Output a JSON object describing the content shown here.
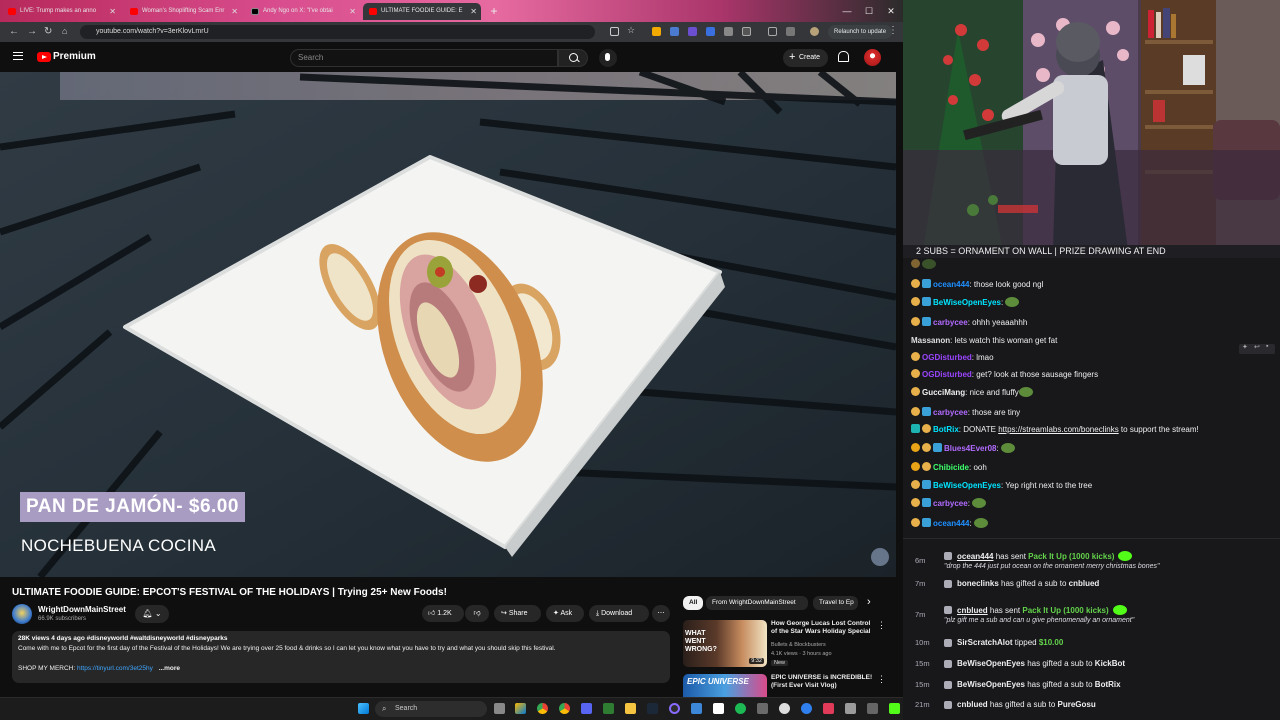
{
  "browser": {
    "tabs": [
      {
        "label": "LIVE: Trump makes an anno"
      },
      {
        "label": "Woman's Shoplifting Scam Enr"
      },
      {
        "label": "Andy Ngo on X: \"I've obtai"
      },
      {
        "label": "ULTIMATE FOODIE GUIDE: E"
      }
    ],
    "url": "youtube.com/watch?v=3erKlovLmrU",
    "relaunch_label": "Relaunch to update"
  },
  "youtube": {
    "brand": "Premium",
    "search_placeholder": "Search",
    "create_label": "Create",
    "caption_title": "PAN DE JAMÓN- $6.00",
    "caption_subtitle": "NOCHEBUENA COCINA",
    "video_title": "ULTIMATE FOODIE GUIDE: EPCOT'S FESTIVAL OF THE HOLIDAYS | Trying 25+ New Foods!",
    "channel_name": "WrightDownMainStreet",
    "channel_subs": "66.9K subscribers",
    "likes": "1.2K",
    "share_label": "Share",
    "ask_label": "Ask",
    "download_label": "Download",
    "description": {
      "meta": "28K views  4 days ago  #disneyworld #waltdisneyworld #disneyparks",
      "text": "Come with me to Epcot for the first day of the Festival of the Holidays! We are trying over 25 food & drinks so I can let you know what you have to try and what you should skip this festival.",
      "merch_label": "SHOP MY MERCH: ",
      "merch_link": "https://tinyurl.com/3et25hy",
      "more": "...more"
    },
    "chips": [
      "All",
      "From WrightDownMainStreet",
      "Travel to Ep"
    ],
    "related": [
      {
        "title": "How George Lucas Lost Control of the Star Wars Holiday Special",
        "channel": "Bullets & Blockbusters",
        "stats": "4.1K views · 3 hours ago",
        "badge": "New",
        "duration": "9:32",
        "thumb_text": "WHAT WENT WRONG?"
      },
      {
        "title": "EPIC UNIVERSE is INCREDIBLE! (First Ever Visit Vlog)",
        "thumb_text": "EPIC UNIVERSE"
      }
    ]
  },
  "chat": {
    "banner": "2 SUBS = ORNAMENT ON WALL | PRIZE DRAWING AT END",
    "messages": [
      {
        "user": "ocean444",
        "text": "those look good ngl",
        "color": "#1e90ff"
      },
      {
        "user": "BeWiseOpenEyes",
        "text": "",
        "color": "#00e5ff"
      },
      {
        "user": "carbycee",
        "text": "ohhh yeaaahhh",
        "color": "#b26bff"
      },
      {
        "user": "Massanon",
        "text": "lets watch this woman get fat",
        "color": "#e0e0e0"
      },
      {
        "user": "OGDisturbed",
        "text": "lmao",
        "color": "#9b45ff"
      },
      {
        "user": "OGDisturbed",
        "text": "get? look at those sausage fingers",
        "color": "#9b45ff"
      },
      {
        "user": "GucciMang",
        "text": "nice and fluffy",
        "color": "#f0f0f0"
      },
      {
        "user": "carbycee",
        "text": "those are tiny",
        "color": "#b26bff"
      },
      {
        "user": "BotRix",
        "text": "DONATE ",
        "link": "https://streamlabs.com/boneclinks",
        "suffix": " to support the stream!",
        "color": "#00e5ff"
      },
      {
        "user": "Blues4Ever08",
        "text": "",
        "color": "#b26bff"
      },
      {
        "user": "Chibicide",
        "text": "ooh",
        "color": "#3cff6a"
      },
      {
        "user": "BeWiseOpenEyes",
        "text": "Yep right next to the tree",
        "color": "#00e5ff"
      },
      {
        "user": "carbycee",
        "text": "",
        "color": "#b26bff"
      },
      {
        "user": "ocean444",
        "text": "",
        "color": "#1e90ff"
      }
    ]
  },
  "events": [
    {
      "time": "6m",
      "user": "ocean444",
      "action": " has sent ",
      "item": "Pack It Up (1000 kicks)",
      "note": "\"drop the 444 just put ocean on the ornament merry christmas bones\""
    },
    {
      "time": "7m",
      "user": "boneclinks",
      "action": " has gifted a sub to ",
      "target": "cnblued"
    },
    {
      "time": "7m",
      "user": "cnblued",
      "action": " has sent ",
      "item": "Pack It Up (1000 kicks)",
      "note": "\"plz gift me a sub and can u give phenomenally an ornament\""
    },
    {
      "time": "10m",
      "user": "SirScratchAlot",
      "action": " tipped ",
      "item": "$10.00"
    },
    {
      "time": "15m",
      "user": "BeWiseOpenEyes",
      "action": " has gifted a sub to ",
      "target": "KickBot"
    },
    {
      "time": "15m",
      "user": "BeWiseOpenEyes",
      "action": " has gifted a sub to ",
      "target": "BotRix"
    },
    {
      "time": "21m",
      "user": "cnblued",
      "action": " has gifted a sub to ",
      "target": "PureGosu"
    }
  ],
  "taskbar": {
    "search_placeholder": "Search"
  }
}
